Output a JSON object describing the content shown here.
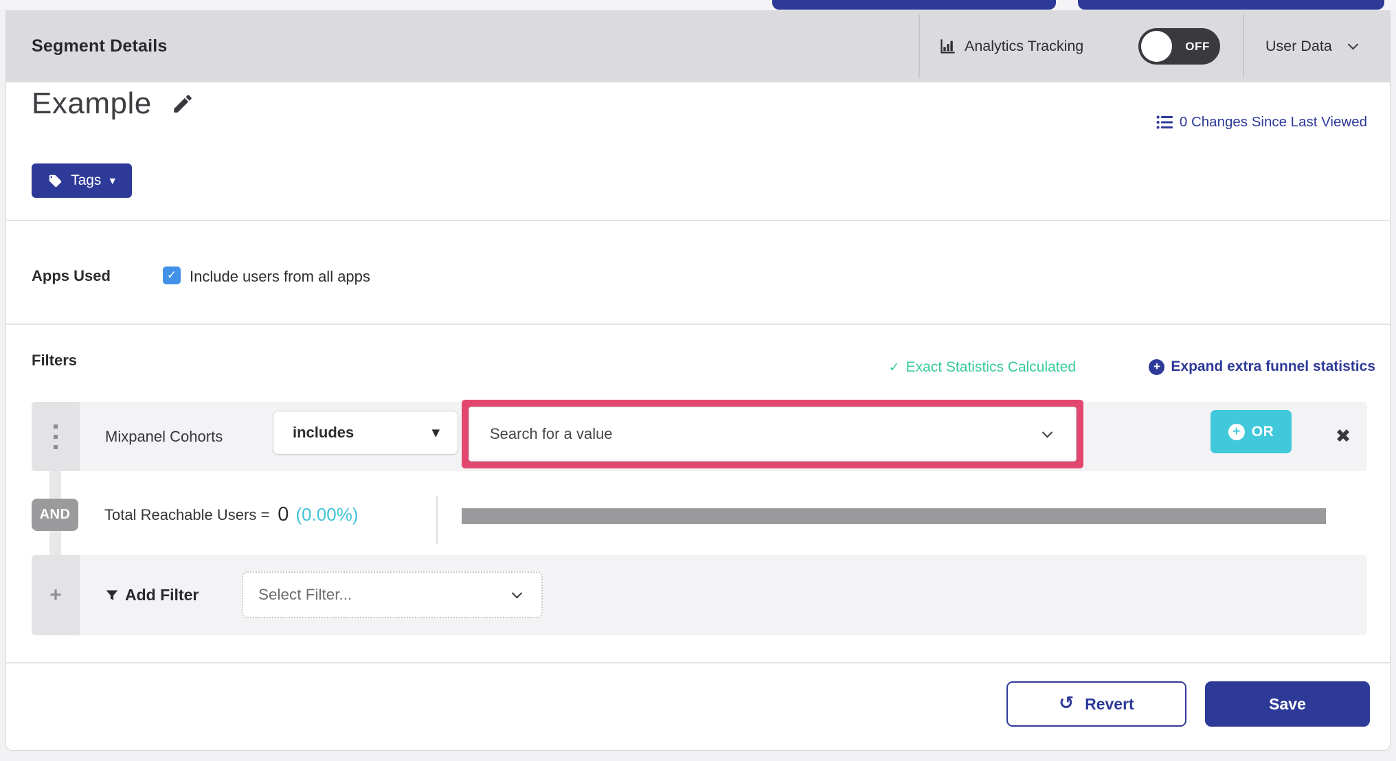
{
  "colors": {
    "navy": "#2e3a98",
    "teal_button": "#41c8da",
    "cyan_text": "#3fc3d8",
    "green_status": "#38cb9c",
    "pink_highlight": "#e2486f",
    "checkbox_blue": "#4191e8",
    "toggle_dark": "#3a3a3e",
    "header_gray": "#dbdbdd",
    "row_gray": "#f3f3f5",
    "badge_gray": "#9b9b9e"
  },
  "header": {
    "title": "Segment Details",
    "analytics_label": "Analytics Tracking",
    "toggle_state": "OFF",
    "user_data_label": "User Data"
  },
  "segment": {
    "name": "Example",
    "changes_link": "0 Changes Since Last Viewed",
    "tags_label": "Tags"
  },
  "apps_used": {
    "label": "Apps Used",
    "checkbox_label": "Include users from all apps",
    "checked": true
  },
  "filters": {
    "heading": "Filters",
    "exact_stats_label": "Exact Statistics Calculated",
    "expand_link_label": "Expand extra funnel statistics",
    "row": {
      "field": "Mixpanel Cohorts",
      "operator": "includes",
      "value_placeholder": "Search for a value",
      "or_label": "OR"
    },
    "and_label": "AND",
    "total_reachable": {
      "label": "Total Reachable Users =",
      "value": "0",
      "percent": "(0.00%)"
    },
    "add_filter": {
      "label": "Add Filter",
      "placeholder": "Select Filter..."
    }
  },
  "footer": {
    "revert_label": "Revert",
    "save_label": "Save"
  },
  "icons": {
    "check": "✓",
    "caret_down": "▼",
    "close": "✖",
    "plus": "+",
    "undo": "↺"
  }
}
